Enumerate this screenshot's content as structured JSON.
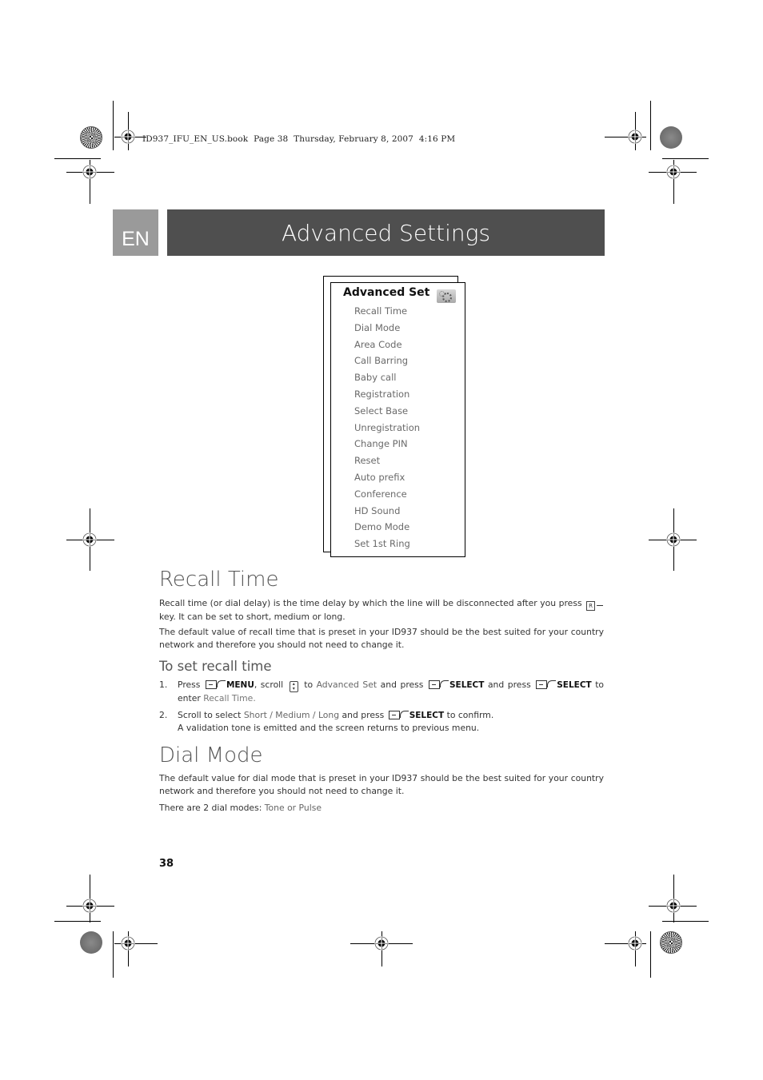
{
  "print_header": "ID937_IFU_EN_US.book  Page 38  Thursday, February 8, 2007  4:16 PM",
  "language_tab": "EN",
  "page_title": "Advanced Settings",
  "menu_screen": {
    "title": "Advanced Set",
    "icon": "gear-icon",
    "items": [
      "Recall Time",
      "Dial Mode",
      "Area Code",
      "Call Barring",
      "Baby call",
      "Registration",
      "Select Base",
      "Unregistration",
      "Change PIN",
      "Reset",
      "Auto prefix",
      "Conference",
      "HD Sound",
      "Demo Mode",
      "Set 1st Ring"
    ]
  },
  "recall_time": {
    "heading": "Recall Time",
    "para1_a": "Recall time (or dial delay) is the time delay by which the line will be disconnected after you press",
    "para1_key_icon": "recall-key-icon",
    "para1_b": "key.  It can be set to short, medium or long.",
    "para2": "The default value of recall time that is preset in your ID937 should be the best suited for your country network and therefore you should not need to change it.",
    "subheading": "To set recall time",
    "steps": [
      {
        "num": "1.",
        "t1": "Press",
        "key1": "MENU",
        "t2": ", scroll",
        "t3": "to",
        "hl1": "Advanced Set",
        "t4": "and press",
        "key2": "SELECT",
        "t5": "and press",
        "key3": "SELECT",
        "t6": "to enter",
        "hl2": "Recall Time",
        "t7": "."
      },
      {
        "num": "2.",
        "t1": "Scroll to select",
        "hl1": "Short / Medium / Long",
        "t2": "and press",
        "key1": "SELECT",
        "t3": "to confirm.",
        "line2": "A validation tone is emitted and the screen returns to previous menu."
      }
    ]
  },
  "dial_mode": {
    "heading": "Dial Mode",
    "para1": "The default value for dial mode that is preset in your ID937 should be the best suited for your country network and therefore you should not need to change it.",
    "para2_a": "There are 2 dial modes:",
    "para2_hl": "Tone or Pulse"
  },
  "page_number": "38"
}
